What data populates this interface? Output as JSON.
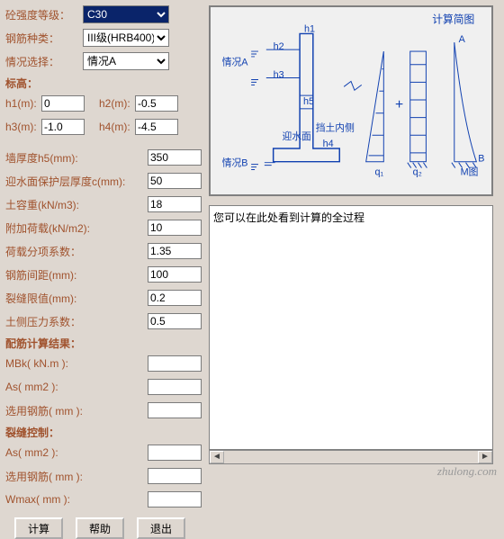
{
  "dropdowns": {
    "grade_label": "砼强度等级：",
    "grade_value": "C30",
    "rebar_label": "钢筋种类：",
    "rebar_value": "III级(HRB400)",
    "case_label": "情况选择：",
    "case_value": "情况A"
  },
  "elev": {
    "section": "标高：",
    "h1_label": "h1(m):",
    "h1_value": "0",
    "h2_label": "h2(m):",
    "h2_value": "-0.5",
    "h3_label": "h3(m):",
    "h3_value": "-1.0",
    "h4_label": "h4(m):",
    "h4_value": "-4.5"
  },
  "params": {
    "h5_label": "墙厚度h5(mm):",
    "h5_value": "350",
    "cover_label": "迎水面保护层厚度c(mm):",
    "cover_value": "50",
    "soil_label": "土容重(kN/m3):",
    "soil_value": "18",
    "addload_label": "附加荷载(kN/m2):",
    "addload_value": "10",
    "loadfac_label": "荷载分项系数：",
    "loadfac_value": "1.35",
    "spacing_label": "钢筋间距(mm):",
    "spacing_value": "100",
    "crack_label": "裂缝限值(mm):",
    "crack_value": "0.2",
    "earth_label": "土侧压力系数：",
    "earth_value": "0.5"
  },
  "results": {
    "rebar_section": "配筋计算结果：",
    "mbk_label": "MBk( kN.m ):",
    "as1_label": "As( mm2 ):",
    "sel1_label": "选用钢筋( mm ):",
    "crack_section": "裂缝控制：",
    "as2_label": "As( mm2 ):",
    "sel2_label": "选用钢筋( mm ):",
    "wmax_label": "Wmax( mm ):"
  },
  "buttons": {
    "calc": "计算",
    "help": "帮助",
    "exit": "退出"
  },
  "diagram": {
    "title": "计算简图",
    "caseA": "情况A",
    "caseB": "情况B",
    "h1": "h1",
    "h2": "h2",
    "h3": "h3",
    "h4": "h4",
    "h5": "h5",
    "water_face": "迎水面",
    "soil_side": "挡土内侧",
    "q1": "q₁",
    "q2": "q₂",
    "M": "M图",
    "A": "A",
    "B": "B",
    "plus": "+"
  },
  "calc_area": {
    "placeholder": "您可以在此处看到计算的全过程"
  },
  "watermark": "zhulong.com"
}
